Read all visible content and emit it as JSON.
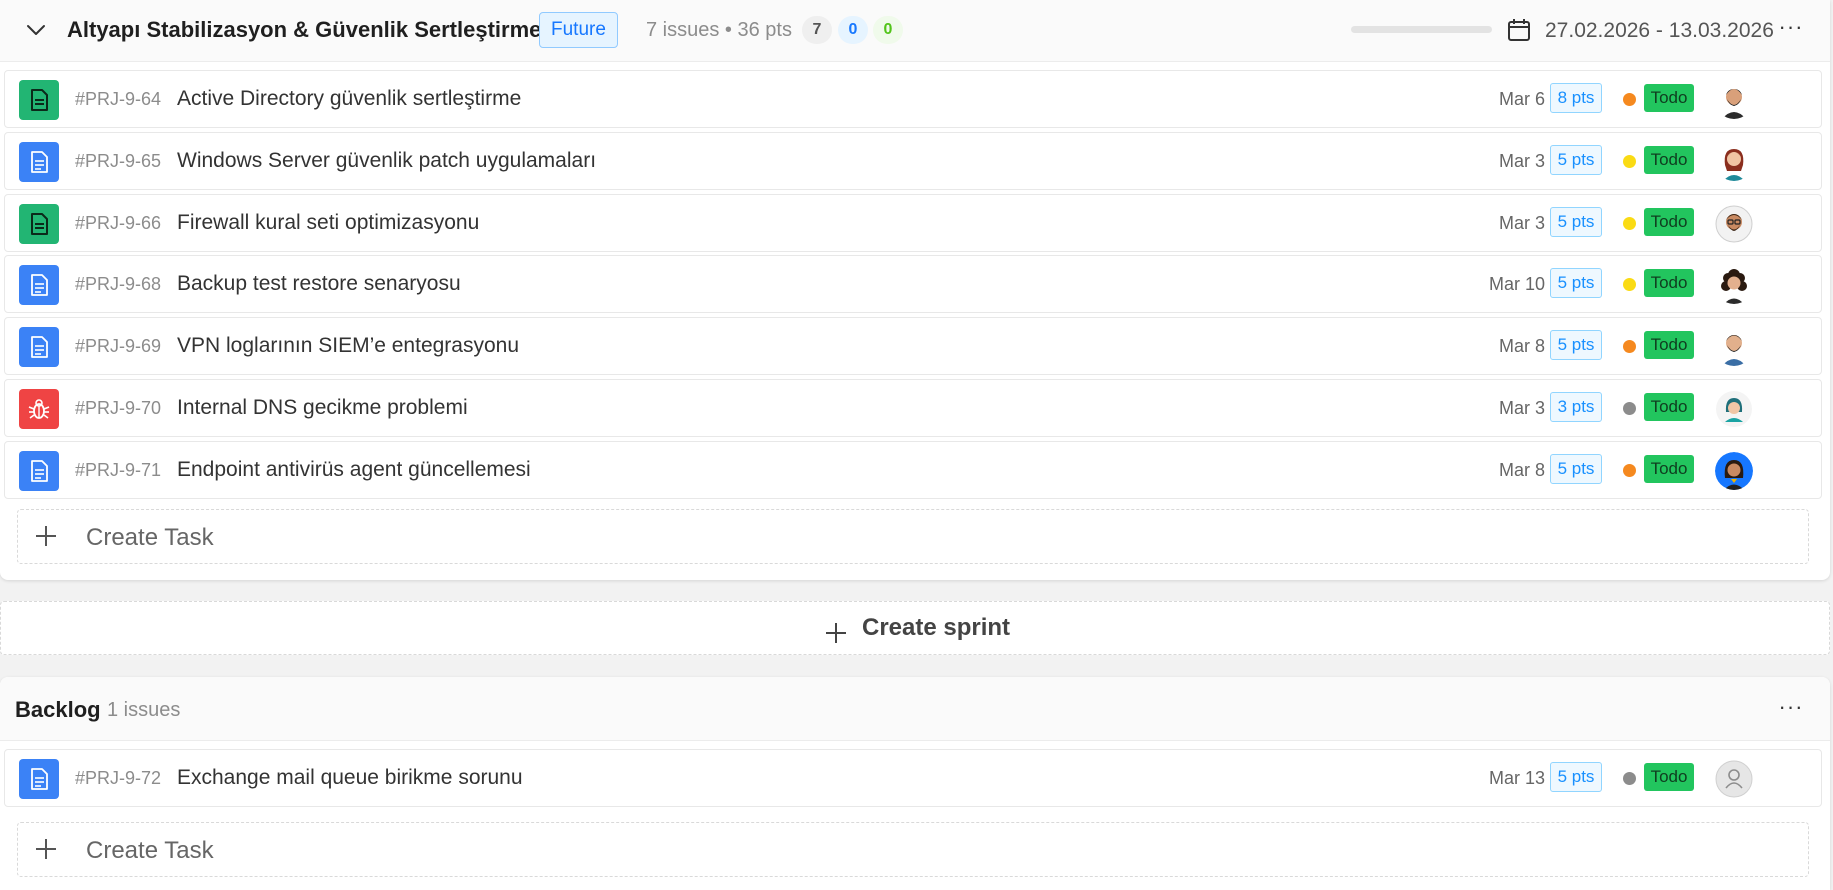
{
  "sprint": {
    "title": "Altyapı Stabilizasyon & Güvenlik Sertleştirme",
    "status_badge": "Future",
    "summary": "7 issues • 36 pts",
    "counts": {
      "todo": "7",
      "in_progress": "0",
      "done": "0"
    },
    "progress_percent": 0,
    "date_range": "27.02.2026 - 13.03.2026",
    "more_label": "···",
    "issues": [
      {
        "key": "#PRJ-9-64",
        "title": "Active Directory güvenlik sertleştirme",
        "date": "Mar 6",
        "points": "8 pts",
        "status": "Todo",
        "type": "story",
        "type_icon": "story-icon",
        "priority_color": "#f5891f",
        "avatar": "avatar-man-beard"
      },
      {
        "key": "#PRJ-9-65",
        "title": "Windows Server güvenlik patch uygulamaları",
        "date": "Mar 3",
        "points": "5 pts",
        "status": "Todo",
        "type": "task",
        "type_icon": "task-icon",
        "priority_color": "#fadb14",
        "avatar": "avatar-woman-auburn"
      },
      {
        "key": "#PRJ-9-66",
        "title": "Firewall kural seti optimizasyonu",
        "date": "Mar 3",
        "points": "5 pts",
        "status": "Todo",
        "type": "story",
        "type_icon": "story-icon",
        "priority_color": "#fadb14",
        "avatar": "avatar-man-glasses"
      },
      {
        "key": "#PRJ-9-68",
        "title": "Backup test restore senaryosu",
        "date": "Mar 10",
        "points": "5 pts",
        "status": "Todo",
        "type": "task",
        "type_icon": "task-icon",
        "priority_color": "#fadb14",
        "avatar": "avatar-woman-curly"
      },
      {
        "key": "#PRJ-9-69",
        "title": "VPN loglarının SIEM’e entegrasyonu",
        "date": "Mar 8",
        "points": "5 pts",
        "status": "Todo",
        "type": "task",
        "type_icon": "task-icon",
        "priority_color": "#f5891f",
        "avatar": "avatar-man-blue-shirt"
      },
      {
        "key": "#PRJ-9-70",
        "title": "Internal DNS gecikme problemi",
        "date": "Mar 3",
        "points": "3 pts",
        "status": "Todo",
        "type": "bug",
        "type_icon": "bug-icon",
        "priority_color": "#8c8c8c",
        "avatar": "avatar-woman-teal"
      },
      {
        "key": "#PRJ-9-71",
        "title": "Endpoint antivirüs agent güncellemesi",
        "date": "Mar 8",
        "points": "5 pts",
        "status": "Todo",
        "type": "task",
        "type_icon": "task-icon",
        "priority_color": "#f5891f",
        "avatar": "avatar-woman-blue-bg"
      }
    ],
    "create_task_label": "Create Task"
  },
  "create_sprint_label": "Create sprint",
  "backlog": {
    "title": "Backlog",
    "count_label": "1 issues",
    "more_label": "···",
    "issues": [
      {
        "key": "#PRJ-9-72",
        "title": "Exchange mail queue birikme sorunu",
        "date": "Mar 13",
        "points": "5 pts",
        "status": "Todo",
        "type": "task",
        "type_icon": "task-icon",
        "priority_color": "#8c8c8c",
        "avatar": "avatar-unassigned"
      }
    ],
    "create_task_label": "Create Task"
  }
}
